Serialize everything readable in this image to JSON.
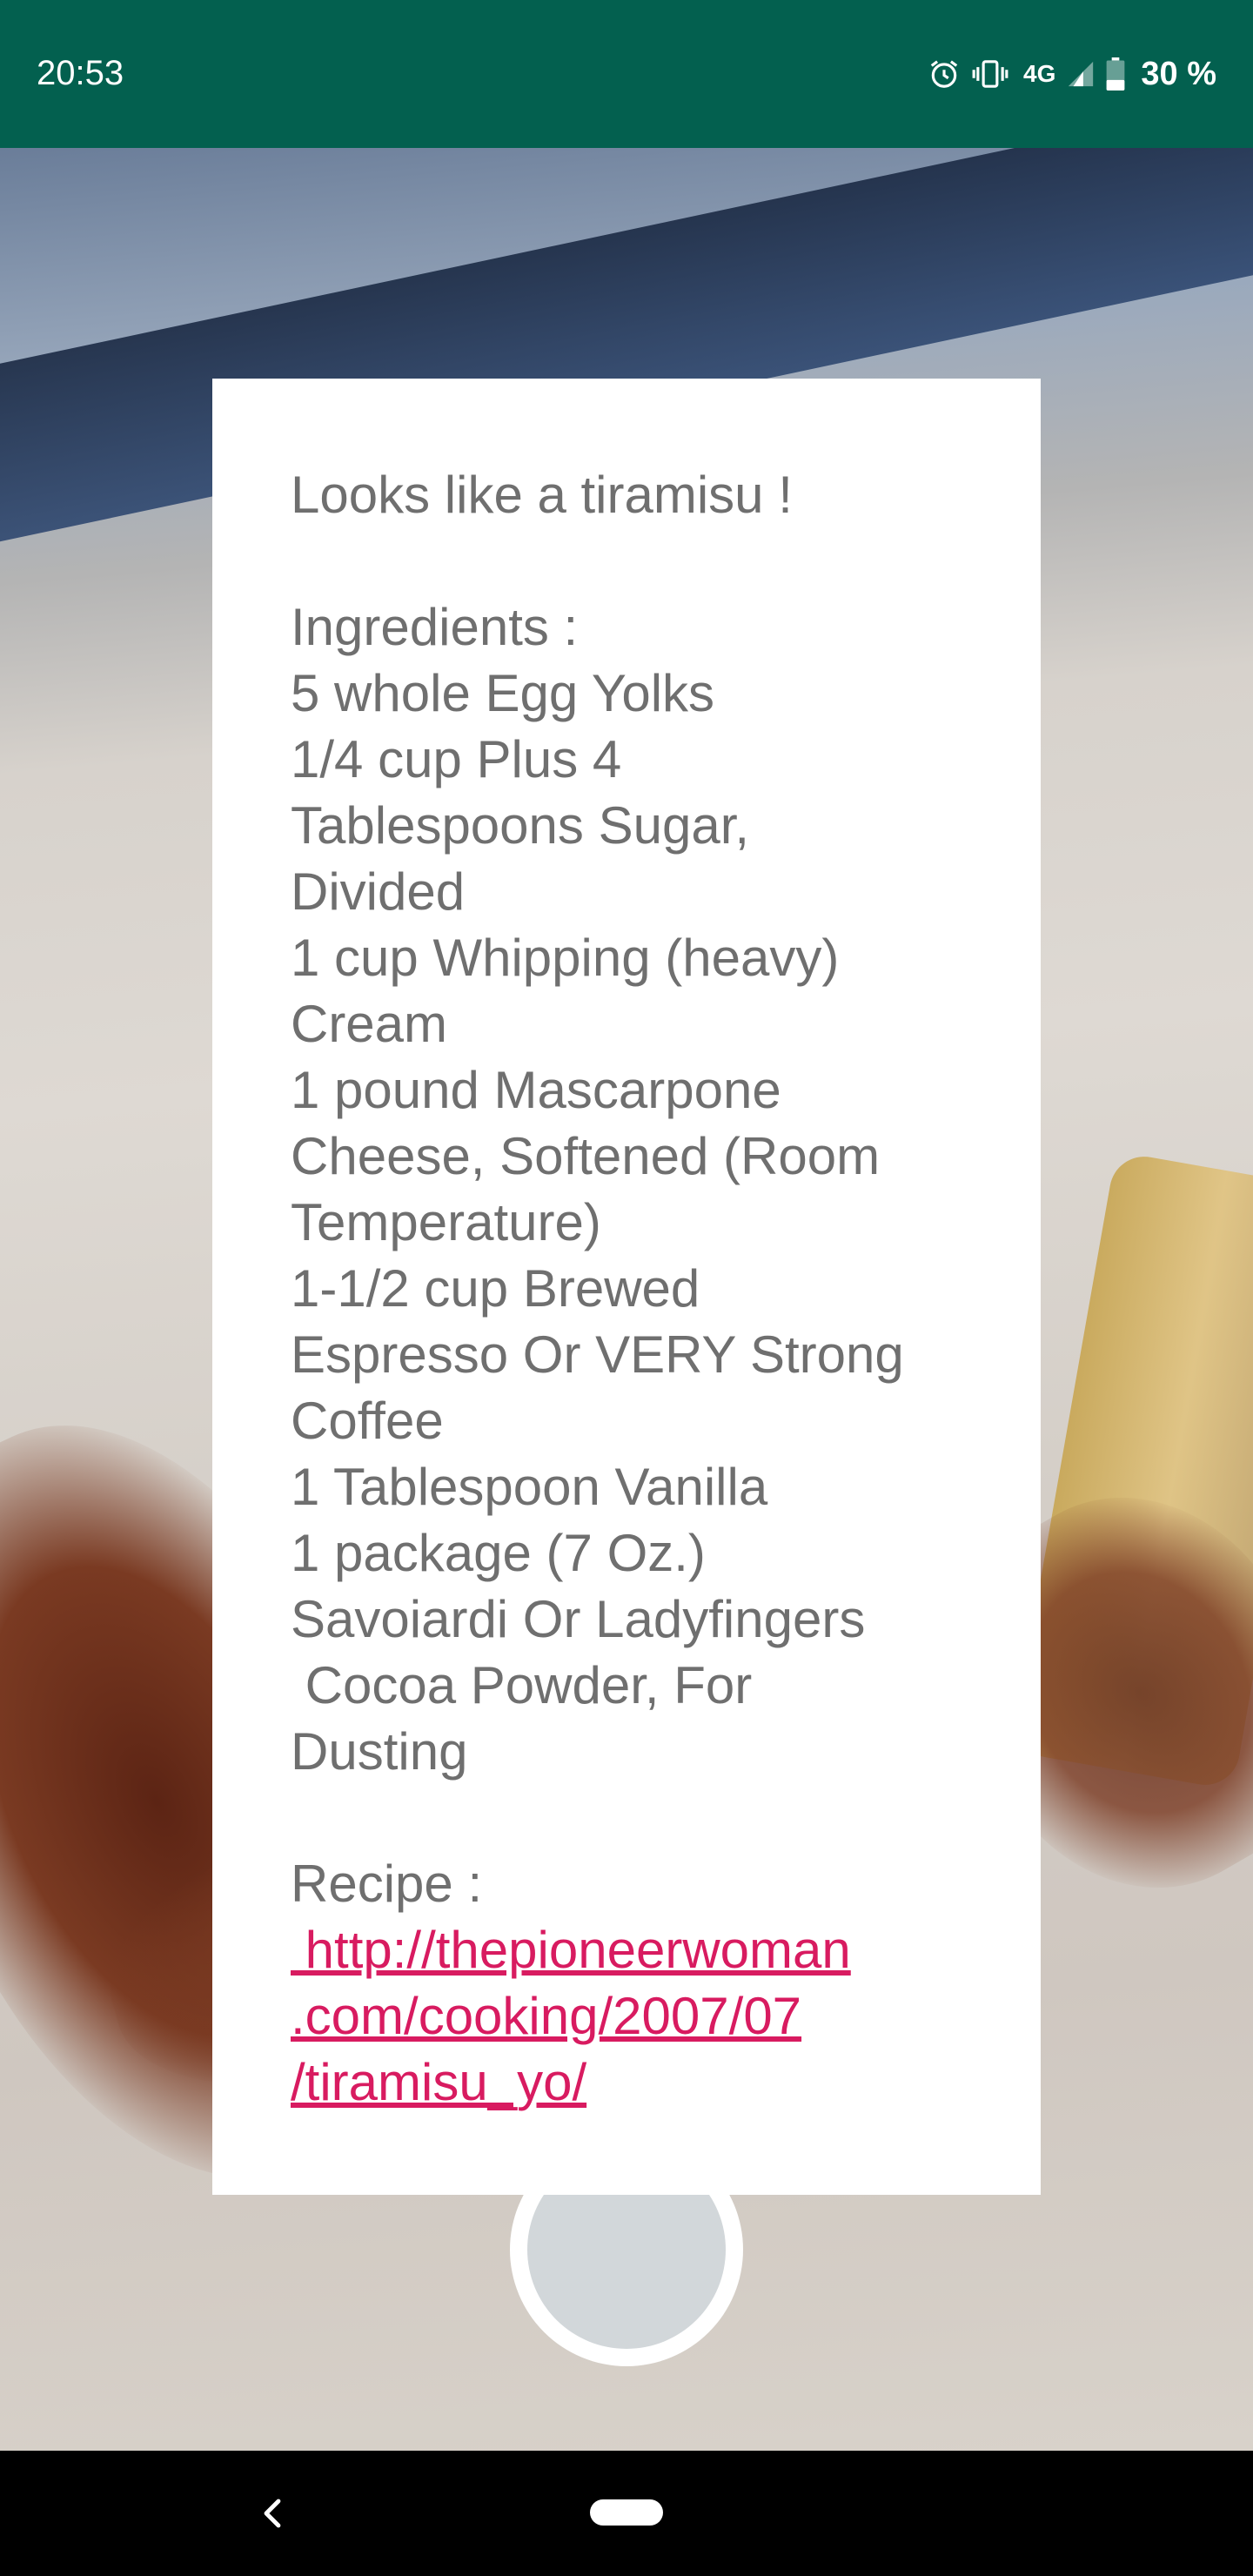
{
  "status_bar": {
    "time": "20:53",
    "network": "4G",
    "battery": "30 %",
    "icons": [
      "alarm-icon",
      "vibrate-icon",
      "signal-icon",
      "battery-icon"
    ]
  },
  "card": {
    "title": "Looks like a tiramisu !",
    "ingredients_heading": "Ingredients :",
    "ingredient_lines": [
      "5 whole Egg Yolks",
      "1/4 cup Plus 4",
      "Tablespoons Sugar,",
      "Divided",
      "1 cup Whipping (heavy)",
      "Cream",
      "1 pound Mascarpone",
      "Cheese, Softened (Room",
      "Temperature)",
      "1-1/2 cup Brewed",
      "Espresso Or VERY Strong",
      "Coffee",
      "1 Tablespoon Vanilla",
      "1 package (7 Oz.)",
      "Savoiardi Or Ladyfingers",
      " Cocoa Powder, For",
      "Dusting"
    ],
    "recipe_heading": "Recipe :",
    "recipe_link_lines": [
      " http://thepioneerwoman",
      ".com/cooking/2007/07",
      "/tiramisu_yo/"
    ]
  },
  "colors": {
    "status_bar": "#03604f",
    "link": "#d81b60",
    "text": "#6f6f6f",
    "shutter_inner": "#d2d7da"
  },
  "nav": {
    "icons": [
      "back-icon",
      "home-pill-icon"
    ]
  }
}
